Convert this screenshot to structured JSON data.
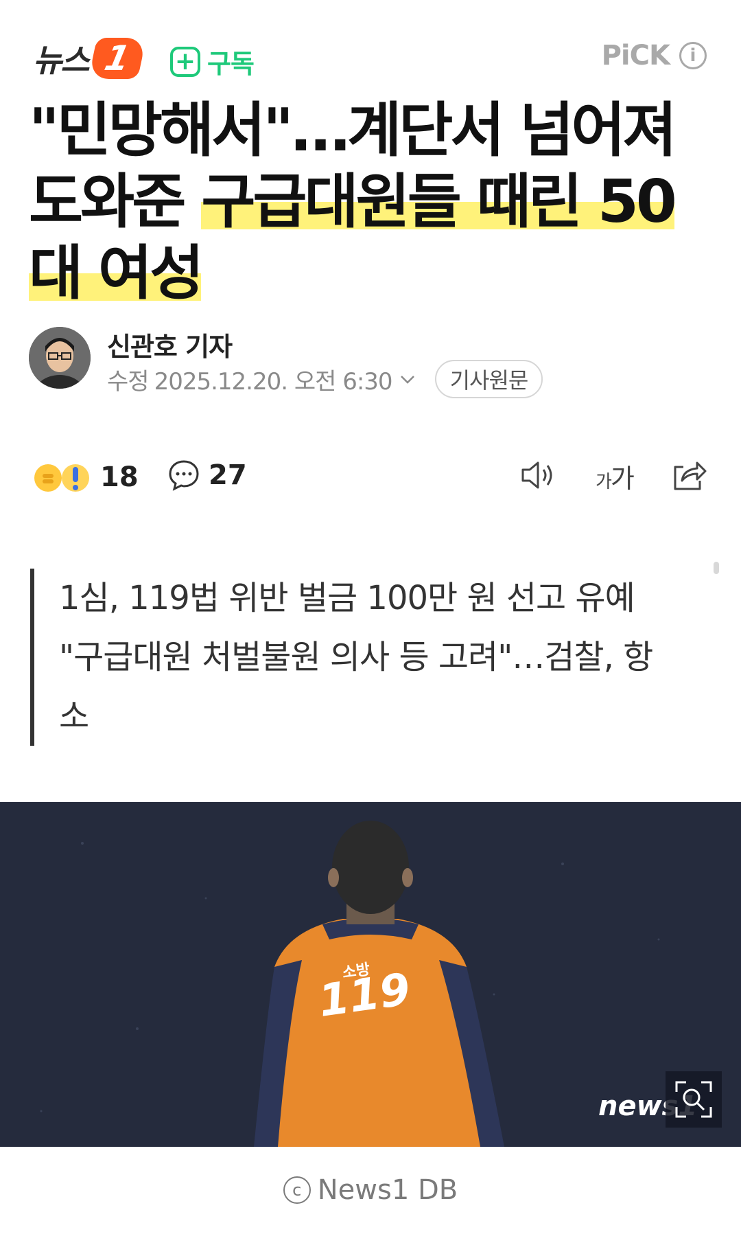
{
  "header": {
    "logo_text": "뉴스",
    "logo_badge": "1",
    "subscribe_icon": "plus-icon",
    "subscribe_label": "구독",
    "pick_label": "PiCK",
    "info_icon": "i"
  },
  "article": {
    "title_plain": "\"민망해서\"…계단서 넘어져 도와준 ",
    "title_highlight": "구급대원들 때린 50대 여성",
    "reporter": "신관호 기자",
    "date_label": "수정",
    "date_value": "2025.12.20. 오전 6:30",
    "original_button": "기사원문"
  },
  "actions": {
    "reaction_count": "18",
    "comment_count": "27",
    "reaction_icon": "thumbs-up-surprised-icon",
    "comment_icon": "speech-bubble-icon",
    "tts_icon": "speaker-icon",
    "font_size_label_small": "가",
    "font_size_label_large": "가",
    "share_icon": "share-icon"
  },
  "summary": {
    "line1": "1심, 119법 위반 벌금 100만 원 선고 유예",
    "line2": "\"구급대원 처벌불원 의사 등 고려\"…검찰, 항",
    "line3": "소"
  },
  "photo": {
    "jacket_text_small": "소방",
    "jacket_text_large": "119",
    "watermark": "news1",
    "zoom_icon": "zoom-in-icon"
  },
  "caption": {
    "copyright_symbol": "c",
    "text": "News1 DB"
  },
  "colors": {
    "brand_orange": "#ff5a1f",
    "subscribe_green": "#1ec97a",
    "highlight_yellow": "#fff27a",
    "photo_background": "#252b3d",
    "jacket_orange": "#e8892c"
  }
}
